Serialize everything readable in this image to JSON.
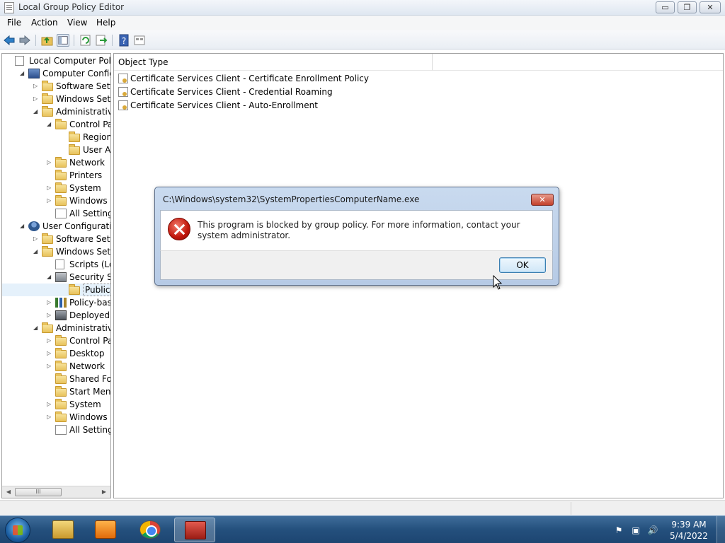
{
  "window": {
    "title": "Local Group Policy Editor",
    "controls": {
      "minimize": "▭",
      "maximize": "❐",
      "close": "✕"
    }
  },
  "menu": [
    "File",
    "Action",
    "View",
    "Help"
  ],
  "toolbar": {
    "icons": [
      "back-arrow-icon",
      "forward-arrow-icon",
      "up-folder-icon",
      "show-hide-tree-icon",
      "refresh-icon",
      "export-list-icon",
      "help-icon",
      "properties-icon"
    ]
  },
  "tree": [
    {
      "label": "Local Computer Policy",
      "icon": "doc",
      "expander": ""
    },
    {
      "label": "Computer Configura",
      "icon": "computer",
      "expander": "◢"
    },
    {
      "label": "Software Settings",
      "icon": "folder",
      "expander": "▷"
    },
    {
      "label": "Windows Setting",
      "icon": "folder",
      "expander": "▷"
    },
    {
      "label": "Administrative Te",
      "icon": "folder",
      "expander": "◢"
    },
    {
      "label": "Control Panel",
      "icon": "folder",
      "expander": "◢"
    },
    {
      "label": "Regional a",
      "icon": "folder",
      "expander": ""
    },
    {
      "label": "User Acco",
      "icon": "folder",
      "expander": ""
    },
    {
      "label": "Network",
      "icon": "folder",
      "expander": "▷"
    },
    {
      "label": "Printers",
      "icon": "folder",
      "expander": ""
    },
    {
      "label": "System",
      "icon": "folder",
      "expander": "▷"
    },
    {
      "label": "Windows Cor",
      "icon": "folder",
      "expander": "▷"
    },
    {
      "label": "All Settings",
      "icon": "settings",
      "expander": ""
    },
    {
      "label": "User Configuration",
      "icon": "user",
      "expander": "◢"
    },
    {
      "label": "Software Settings",
      "icon": "folder",
      "expander": "▷"
    },
    {
      "label": "Windows Setting",
      "icon": "folder",
      "expander": "◢"
    },
    {
      "label": "Scripts (Logor",
      "icon": "doc",
      "expander": ""
    },
    {
      "label": "Security Settir",
      "icon": "security",
      "expander": "◢"
    },
    {
      "label": "Public Key",
      "icon": "folder",
      "expander": ""
    },
    {
      "label": "Policy-based",
      "icon": "chart",
      "expander": "▷"
    },
    {
      "label": "Deployed Prir",
      "icon": "printer",
      "expander": "▷"
    },
    {
      "label": "Administrative Te",
      "icon": "folder",
      "expander": "◢"
    },
    {
      "label": "Control Panel",
      "icon": "folder",
      "expander": "▷"
    },
    {
      "label": "Desktop",
      "icon": "folder",
      "expander": "▷"
    },
    {
      "label": "Network",
      "icon": "folder",
      "expander": "▷"
    },
    {
      "label": "Shared Folder",
      "icon": "folder",
      "expander": ""
    },
    {
      "label": "Start Menu ar",
      "icon": "folder",
      "expander": ""
    },
    {
      "label": "System",
      "icon": "folder",
      "expander": "▷"
    },
    {
      "label": "Windows Cor",
      "icon": "folder",
      "expander": "▷"
    },
    {
      "label": "All Settings",
      "icon": "settings",
      "expander": ""
    }
  ],
  "tree_scroll": {
    "left": "◀",
    "right": "▶",
    "thumb": "III"
  },
  "list": {
    "column": "Object Type",
    "rows": [
      "Certificate Services Client - Certificate Enrollment Policy",
      "Certificate Services Client - Credential Roaming",
      "Certificate Services Client - Auto-Enrollment"
    ]
  },
  "dialog": {
    "title": "C:\\Windows\\system32\\SystemPropertiesComputerName.exe",
    "message": "This program is blocked by group policy. For more information, contact your system administrator.",
    "ok": "OK",
    "close": "✕"
  },
  "taskbar": {
    "apps": [
      "windows-explorer",
      "windows-media-player",
      "google-chrome",
      "group-policy-editor"
    ],
    "tray": [
      "network-warning-icon",
      "network-icon",
      "volume-icon"
    ],
    "tray_glyphs": [
      "⚑",
      "▣",
      "🔊"
    ],
    "time": "9:39 AM",
    "date": "5/4/2022"
  }
}
